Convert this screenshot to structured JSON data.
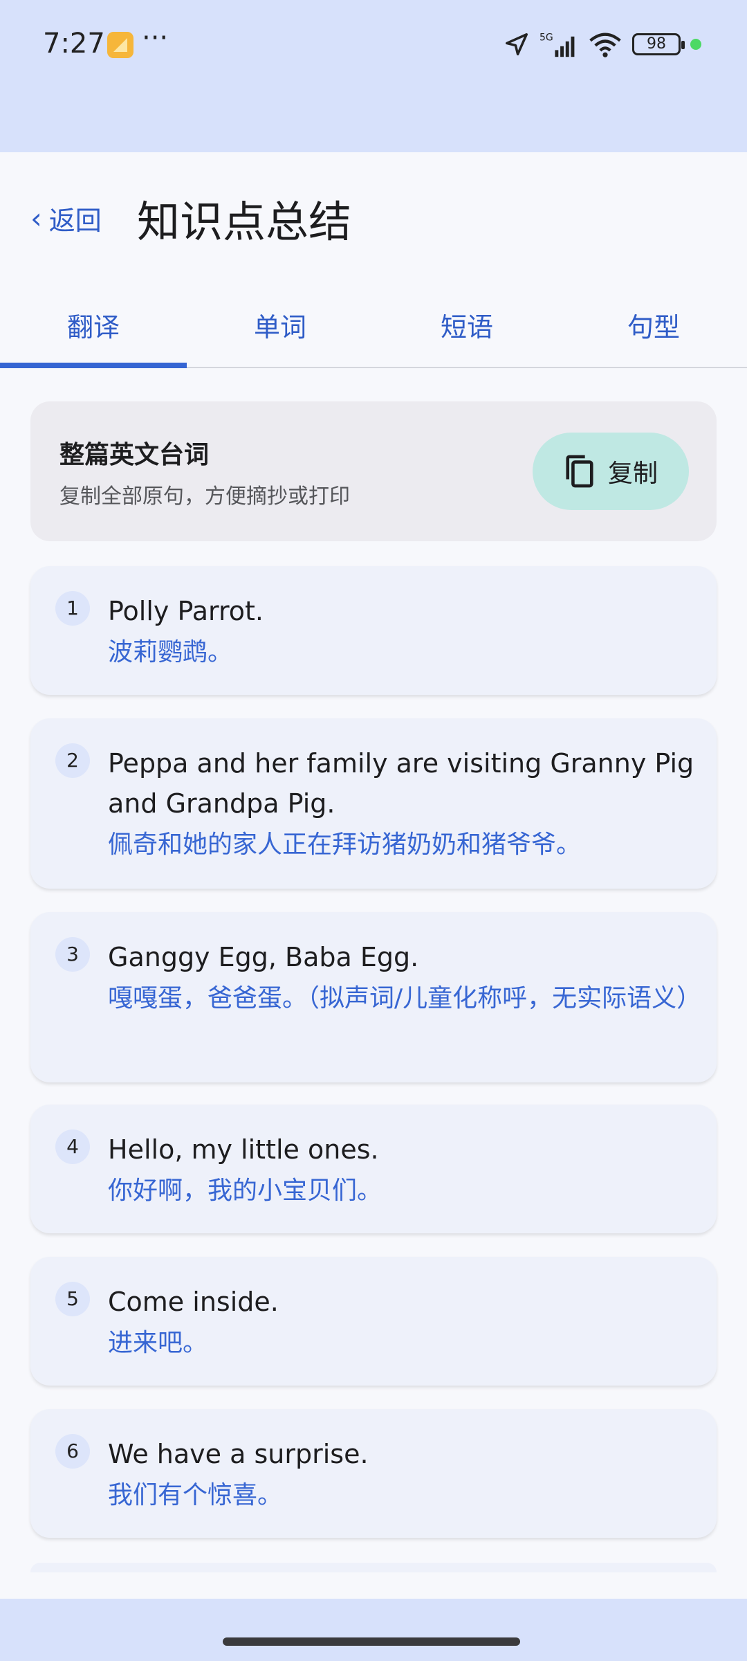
{
  "status": {
    "time": "7:27",
    "dots": "···",
    "network": "5G",
    "battery": "98"
  },
  "header": {
    "back_label": "返回",
    "back_chevron": "‹",
    "title": "知识点总结"
  },
  "tabs": [
    {
      "label": "翻译",
      "active": true
    },
    {
      "label": "单词",
      "active": false
    },
    {
      "label": "短语",
      "active": false
    },
    {
      "label": "句型",
      "active": false
    }
  ],
  "copy_card": {
    "title": "整篇英文台词",
    "subtitle": "复制全部原句，方便摘抄或打印",
    "button_label": "复制"
  },
  "sentences": [
    {
      "num": "1",
      "en": "Polly Parrot.",
      "zh": "波莉鹦鹉。"
    },
    {
      "num": "2",
      "en": "Peppa and her family are visiting Granny Pig and Grandpa Pig.",
      "zh": "佩奇和她的家人正在拜访猪奶奶和猪爷爷。"
    },
    {
      "num": "3",
      "en": "Ganggy Egg, Baba Egg.",
      "zh": "嘎嘎蛋，爸爸蛋。（拟声词/儿童化称呼，无实际语义）"
    },
    {
      "num": "4",
      "en": "Hello, my little ones.",
      "zh": "你好啊，我的小宝贝们。"
    },
    {
      "num": "5",
      "en": "Come inside.",
      "zh": "进来吧。"
    },
    {
      "num": "6",
      "en": "We have a surprise.",
      "zh": "我们有个惊喜。"
    }
  ],
  "colors": {
    "accent": "#3565d3",
    "status_bg": "#d7e1fb",
    "copy_button_bg": "#bfe8e3"
  }
}
